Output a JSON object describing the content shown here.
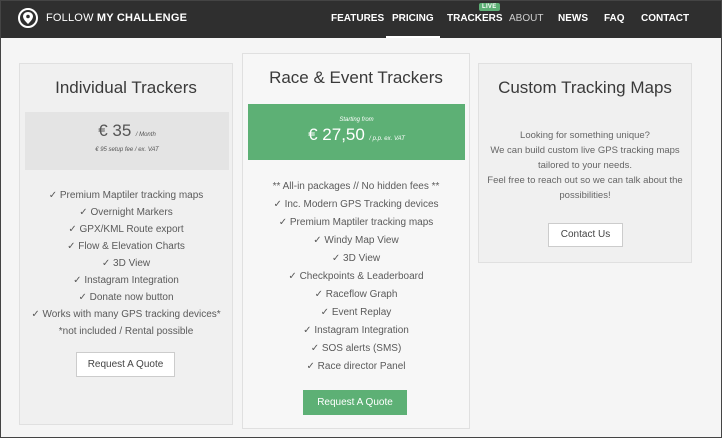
{
  "nav": {
    "logo_text_bold": "FOLLOW",
    "logo_text_rest": "MY CHALLENGE",
    "items": [
      {
        "label": "FEATURES"
      },
      {
        "label": "PRICING"
      },
      {
        "label": "TRACKERS"
      },
      {
        "label": "ABOUT"
      },
      {
        "label": "NEWS"
      },
      {
        "label": "FAQ"
      },
      {
        "label": "CONTACT"
      }
    ],
    "live_badge": "LIVE",
    "active": "PRICING"
  },
  "cards": {
    "individual": {
      "title": "Individual Trackers",
      "price": "€ 35",
      "price_unit": "/ Month",
      "price_note": "€ 95 setup fee / ex. VAT",
      "features": [
        "✓ Premium Maptiler tracking maps",
        "✓ Overnight Markers",
        "✓ GPX/KML Route export",
        "✓ Flow & Elevation Charts",
        "✓ 3D View",
        "✓ Instagram Integration",
        "✓ Donate now button",
        "✓ Works with many GPS tracking devices*",
        "*not included / Rental possible"
      ],
      "button": "Request A Quote"
    },
    "race": {
      "title": "Race & Event Trackers",
      "price_label": "Starting from",
      "price": "€ 27,50",
      "price_unit": "/ p.p. ex. VAT",
      "features": [
        "** All-in packages // No hidden fees **",
        "✓ Inc. Modern GPS Tracking devices",
        "✓ Premium Maptiler tracking maps",
        "✓ Windy Map View",
        "✓ 3D View",
        "✓ Checkpoints & Leaderboard",
        "✓ Raceflow Graph",
        "✓ Event Replay",
        "✓ Instagram Integration",
        "✓ SOS alerts (SMS)",
        "✓ Race director Panel"
      ],
      "button": "Request A Quote"
    },
    "custom": {
      "title": "Custom Tracking Maps",
      "lines": [
        "Looking for something unique?",
        "We can build custom live GPS tracking maps",
        "tailored to your needs.",
        "Feel free to reach out so we can talk about the",
        "possibilities!"
      ],
      "button": "Contact Us"
    }
  },
  "colors": {
    "nav_bg": "#2f2f2f",
    "accent_green": "#5db075",
    "card_bg": "#f0f0f0"
  }
}
